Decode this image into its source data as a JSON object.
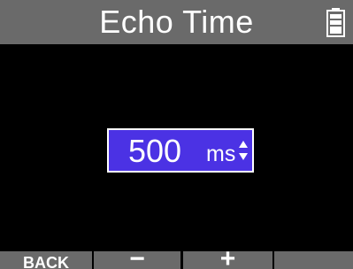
{
  "header": {
    "title": "Echo Time",
    "battery_icon": "battery-full-icon"
  },
  "setting": {
    "value": "500",
    "unit": "ms",
    "adjust_icon": "up-down-arrows-icon"
  },
  "function_keys": {
    "key1": "BACK",
    "key2": "−",
    "key3": "+",
    "key4": ""
  },
  "colors": {
    "title_bar": "#6a6a6a",
    "selection_box": "#4b32e4",
    "background": "#000000",
    "text": "#ffffff"
  }
}
